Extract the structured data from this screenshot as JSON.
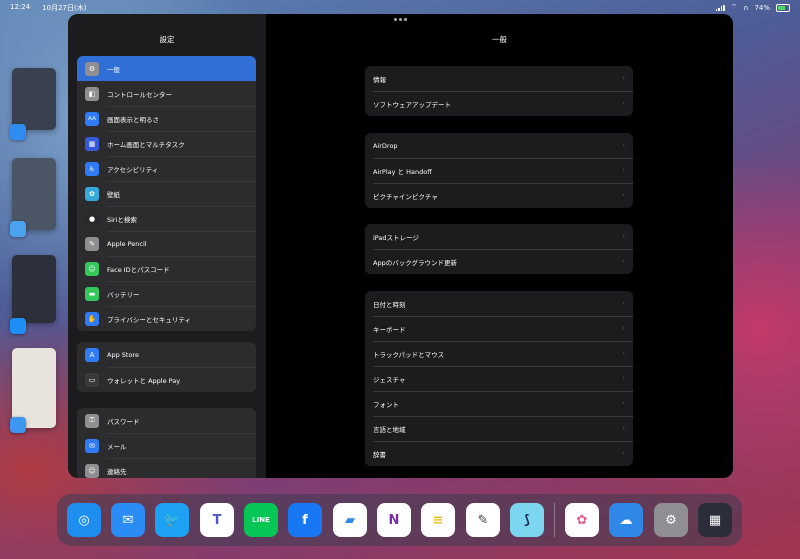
{
  "status_bar": {
    "time": "12:24",
    "date": "10月27日(木)",
    "battery": "74%",
    "battery_level": 0.74
  },
  "sidebar": {
    "title": "設定",
    "groups": [
      [
        {
          "label": "一般",
          "icon": "gear-icon",
          "color": "#8e8e93",
          "active": true
        },
        {
          "label": "コントロールセンター",
          "icon": "switches-icon",
          "color": "#8e8e93"
        },
        {
          "label": "画面表示と明るさ",
          "icon": "aa-icon",
          "color": "#2f7cf6"
        },
        {
          "label": "ホーム画面とマルチタスク",
          "icon": "grid-icon",
          "color": "#3559d8"
        },
        {
          "label": "アクセシビリティ",
          "icon": "accessibility-icon",
          "color": "#2f7cf6"
        },
        {
          "label": "壁紙",
          "icon": "flower-icon",
          "color": "#34aadc"
        },
        {
          "label": "Siriと検索",
          "icon": "siri-icon",
          "color": "#2a2a2e"
        },
        {
          "label": "Apple Pencil",
          "icon": "pencil-icon",
          "color": "#8e8e93"
        },
        {
          "label": "Face IDとパスコード",
          "icon": "faceid-icon",
          "color": "#34c759"
        },
        {
          "label": "バッテリー",
          "icon": "battery-icon",
          "color": "#34c759"
        },
        {
          "label": "プライバシーとセキュリティ",
          "icon": "hand-icon",
          "color": "#2f7cf6"
        }
      ],
      [
        {
          "label": "App Store",
          "icon": "appstore-icon",
          "color": "#2f7cf6"
        },
        {
          "label": "ウォレットと Apple Pay",
          "icon": "wallet-icon",
          "color": "#3a3a3c"
        }
      ],
      [
        {
          "label": "パスワード",
          "icon": "key-icon",
          "color": "#8e8e93"
        },
        {
          "label": "メール",
          "icon": "mail-icon",
          "color": "#2f7cf6"
        },
        {
          "label": "連絡先",
          "icon": "contacts-icon",
          "color": "#8e8e93"
        }
      ]
    ]
  },
  "detail": {
    "title": "一般",
    "groups": [
      [
        "情報",
        "ソフトウェアアップデート"
      ],
      [
        "AirDrop",
        "AirPlay と Handoff",
        "ピクチャインピクチャ"
      ],
      [
        "iPadストレージ",
        "Appのバックグラウンド更新"
      ],
      [
        "日付と時刻",
        "キーボード",
        "トラックパッドとマウス",
        "ジェスチャ",
        "フォント",
        "言語と地域",
        "辞書"
      ]
    ]
  },
  "dock": {
    "apps": [
      {
        "name": "safari-icon",
        "color": "#1e8ef0",
        "glyph": "◎"
      },
      {
        "name": "mail-icon",
        "color": "#2a8cf5",
        "glyph": "✉"
      },
      {
        "name": "twitter-icon",
        "color": "#1da1f2",
        "glyph": "🐦"
      },
      {
        "name": "teams-icon",
        "color": "#ffffff",
        "glyph": "T"
      },
      {
        "name": "line-icon",
        "color": "#06c755",
        "glyph": "LINE"
      },
      {
        "name": "facebook-icon",
        "color": "#1877f2",
        "glyph": "f"
      },
      {
        "name": "files-icon",
        "color": "#ffffff",
        "glyph": "▰"
      },
      {
        "name": "onenote-icon",
        "color": "#ffffff",
        "glyph": "N"
      },
      {
        "name": "notes-icon",
        "color": "#ffffff",
        "glyph": "≡"
      },
      {
        "name": "goodnotes-icon",
        "color": "#ffffff",
        "glyph": "✎"
      },
      {
        "name": "concepts-icon",
        "color": "#7cd6f0",
        "glyph": "⟆"
      },
      {
        "name": "photos-icon",
        "color": "#ffffff",
        "glyph": "✿"
      },
      {
        "name": "weather-icon",
        "color": "#2f88e8",
        "glyph": "☁"
      },
      {
        "name": "settings-icon",
        "color": "#8e8e93",
        "glyph": "⚙"
      },
      {
        "name": "app-library-icon",
        "color": "#2b2e3a",
        "glyph": "▦"
      }
    ]
  }
}
